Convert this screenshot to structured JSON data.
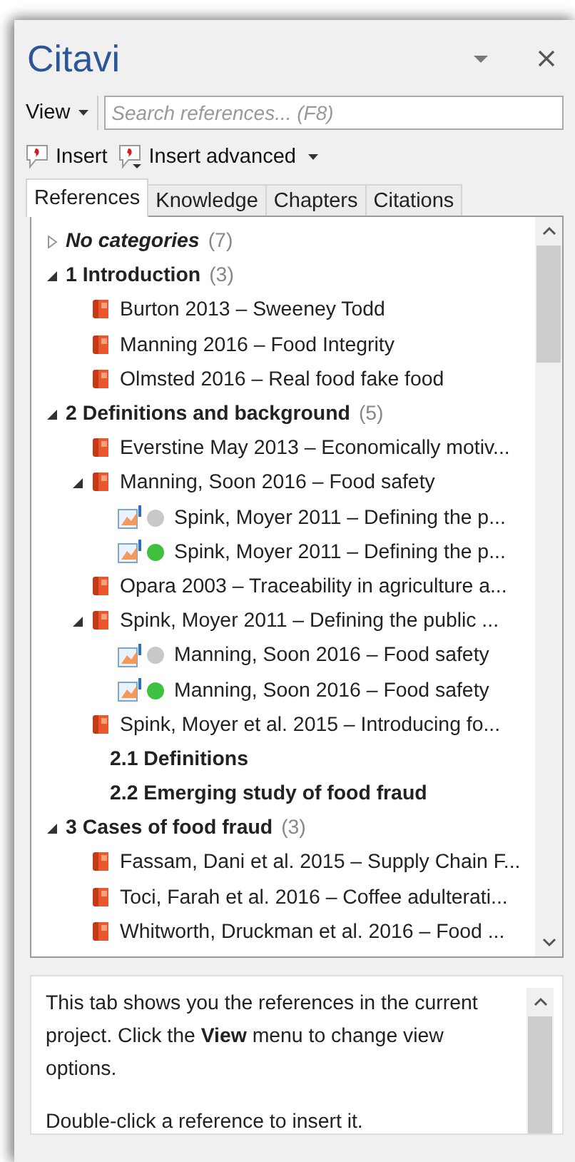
{
  "window": {
    "title": "Citavi"
  },
  "toolbar": {
    "view_menu": "View",
    "search": {
      "placeholder": "Search references... (F8)"
    }
  },
  "actions": [
    {
      "label": "Insert",
      "dropdown": false
    },
    {
      "label": "Insert advanced",
      "dropdown": true
    }
  ],
  "tabs": [
    {
      "label": "References",
      "selected": true
    },
    {
      "label": "Knowledge",
      "selected": false
    },
    {
      "label": "Chapters",
      "selected": false
    },
    {
      "label": "Citations",
      "selected": false
    }
  ],
  "tree": [
    {
      "kind": "virtual",
      "label": "No categories",
      "count": "(7)",
      "expanded": false
    },
    {
      "kind": "category",
      "label": "1 Introduction",
      "count": "(3)",
      "expanded": true,
      "children": [
        {
          "kind": "reference",
          "label": "Burton 2013 – Sweeney Todd"
        },
        {
          "kind": "reference",
          "label": "Manning 2016 – Food Integrity"
        },
        {
          "kind": "reference",
          "label": "Olmsted 2016 – Real food fake food"
        }
      ]
    },
    {
      "kind": "category",
      "label": "2 Definitions and background",
      "count": "(5)",
      "expanded": true,
      "children": [
        {
          "kind": "reference",
          "label": "Everstine May 2013 – Economically motiv..."
        },
        {
          "kind": "reference",
          "label": "Manning, Soon 2016 – Food safety",
          "expanded": true,
          "children": [
            {
              "kind": "citation",
              "label": "Spink, Moyer 2011 – Defining the p...",
              "color": "#c8c8c8"
            },
            {
              "kind": "citation",
              "label": "Spink, Moyer 2011 – Defining the p...",
              "color": "#3fc03f"
            }
          ]
        },
        {
          "kind": "reference",
          "label": "Opara 2003 – Traceability in agriculture a..."
        },
        {
          "kind": "reference",
          "label": "Spink, Moyer 2011 – Defining the public ...",
          "expanded": true,
          "children": [
            {
              "kind": "citation",
              "label": "Manning, Soon 2016 – Food safety",
              "color": "#c8c8c8"
            },
            {
              "kind": "citation",
              "label": "Manning, Soon 2016 – Food safety",
              "color": "#3fc03f"
            }
          ]
        },
        {
          "kind": "reference",
          "label": "Spink, Moyer et al. 2015 – Introducing fo..."
        },
        {
          "kind": "category",
          "label": "2.1 Definitions"
        },
        {
          "kind": "category",
          "label": "2.2 Emerging study of food fraud"
        }
      ]
    },
    {
      "kind": "category",
      "label": "3 Cases of food fraud",
      "count": "(3)",
      "expanded": true,
      "children": [
        {
          "kind": "reference",
          "label": "Fassam, Dani et al. 2015 – Supply Chain F..."
        },
        {
          "kind": "reference",
          "label": "Toci, Farah et al. 2016 – Coffee adulterati..."
        },
        {
          "kind": "reference",
          "label": "Whitworth, Druckman et al. 2016 – Food ..."
        }
      ]
    }
  ],
  "help": [
    "This tab shows you the references in the current project. Click the **View** menu to change view options.",
    "Double-click a reference to insert it."
  ]
}
